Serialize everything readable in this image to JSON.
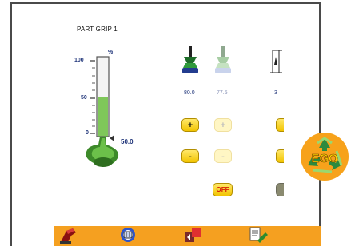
{
  "screen": {
    "title": "PART GRIP 1"
  },
  "gauge": {
    "unit": "%",
    "ticks": [
      "100",
      "50",
      "0"
    ],
    "level_percent": 50,
    "value_label": "50.0"
  },
  "grippers": [
    {
      "name": "gripper-1",
      "reading": "80.0",
      "state": "active"
    },
    {
      "name": "gripper-2",
      "reading": "77.5",
      "state": "disabled"
    },
    {
      "name": "gripper-3",
      "reading": "3",
      "state": "partially-visible"
    }
  ],
  "buttons": {
    "plus": "+",
    "minus": "-",
    "off": "OFF"
  },
  "toolbar": {
    "items": [
      "robot-arm-icon",
      "gripper-cycle-icon",
      "part-transfer-icon",
      "document-edit-icon"
    ]
  },
  "badge": {
    "text": "EGO",
    "icon": "recycle-icon"
  },
  "colors": {
    "accent": "#f5a020",
    "button": "#f2c400",
    "gauge_fill": "#7fc75a",
    "label": "#20357a",
    "off_text": "#d42000",
    "badge": "#f7a21b"
  }
}
